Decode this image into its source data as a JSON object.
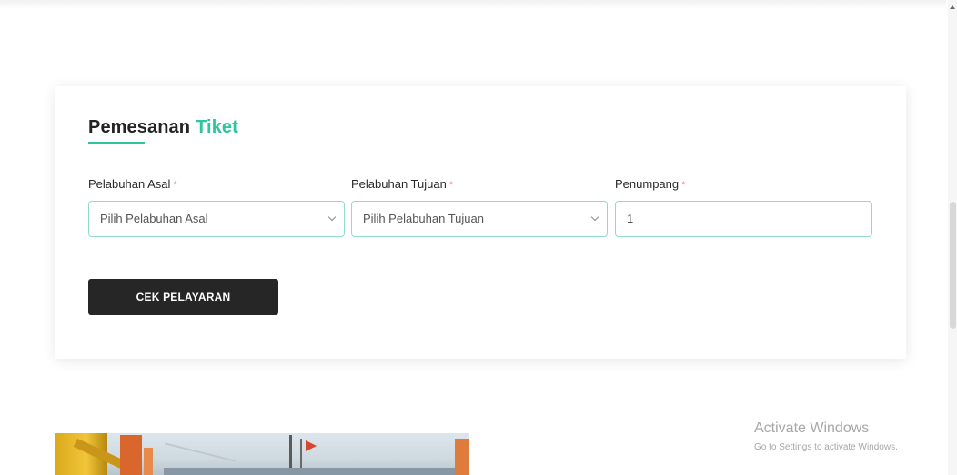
{
  "form": {
    "title": "Pemesanan",
    "title_accent": "Tiket",
    "fields": [
      {
        "label": "Pelabuhan Asal",
        "required_mark": "*",
        "value": "Pilih Pelabuhan Asal"
      },
      {
        "label": "Pelabuhan Tujuan",
        "required_mark": "*",
        "value": "Pilih Pelabuhan Tujuan"
      },
      {
        "label": "Penumpang",
        "required_mark": "*",
        "value": "1"
      }
    ],
    "submit_label": "CEK PELAYARAN"
  },
  "watermark": {
    "title": "Activate Windows",
    "subtitle": "Go to Settings to activate Windows."
  },
  "colors": {
    "accent": "#2fc4a0",
    "button_bg": "#262626",
    "input_border": "#8fdcc9",
    "required": "#e07b7b"
  },
  "icons": [
    "chevron-down-icon",
    "chevron-down-icon",
    "scroll-up-arrow-icon"
  ]
}
